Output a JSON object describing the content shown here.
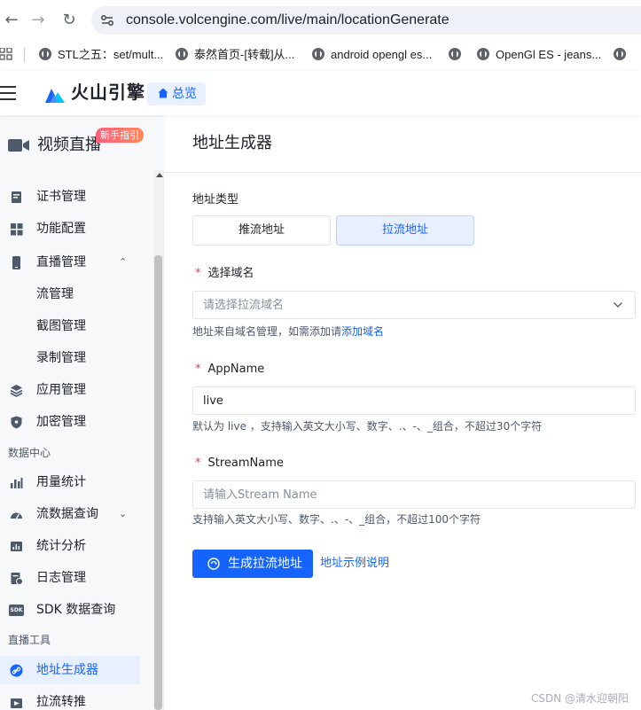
{
  "browser": {
    "url": "console.volcengine.com/live/main/locationGenerate",
    "bookmarks": [
      "STL之五：set/mult...",
      "泰然首页-[转载]从...",
      "android opengl es...",
      "OpenGl ES - jeans..."
    ]
  },
  "header": {
    "brand": "火山引擎",
    "overview": "总览"
  },
  "sidebar": {
    "product": "视频直播",
    "guide_badge": "新手指引",
    "items": {
      "cert": "证书管理",
      "feature": "功能配置",
      "live_manage": "直播管理",
      "stream_manage": "流管理",
      "snapshot": "截图管理",
      "record": "录制管理",
      "app_manage": "应用管理",
      "encrypt": "加密管理",
      "data_center": "数据中心",
      "usage": "用量统计",
      "stream_query": "流数据查询",
      "analytics": "统计分析",
      "logs": "日志管理",
      "sdk_query": "SDK 数据查询",
      "live_tools": "直播工具",
      "address_gen": "地址生成器",
      "pull_push": "拉流转推"
    },
    "sdk_badge": "SDK"
  },
  "main": {
    "title": "地址生成器",
    "address_type_label": "地址类型",
    "push_label": "推流地址",
    "pull_label": "拉流地址",
    "domain_label": "选择域名",
    "domain_placeholder": "请选择拉流域名",
    "domain_hint": "地址来自域名管理，如需添加请",
    "domain_hint_link": "添加域名",
    "appname_label": "AppName",
    "appname_value": "live",
    "appname_hint": "默认为 live ，支持输入英文大小写、数字、.、-、_组合，不超过30个字符",
    "streamname_label": "StreamName",
    "streamname_placeholder": "请输入Stream Name",
    "streamname_hint": "支持输入英文大小写、数字、.、-、_组合，不超过100个字符",
    "generate_button": "生成拉流地址",
    "example_link": "地址示例说明",
    "required_mark": "*"
  },
  "watermark": "CSDN @清水迎朝阳",
  "colors": {
    "primary": "#1664ff",
    "active_bg": "#e8f0ff",
    "required": "#f53f3f"
  }
}
